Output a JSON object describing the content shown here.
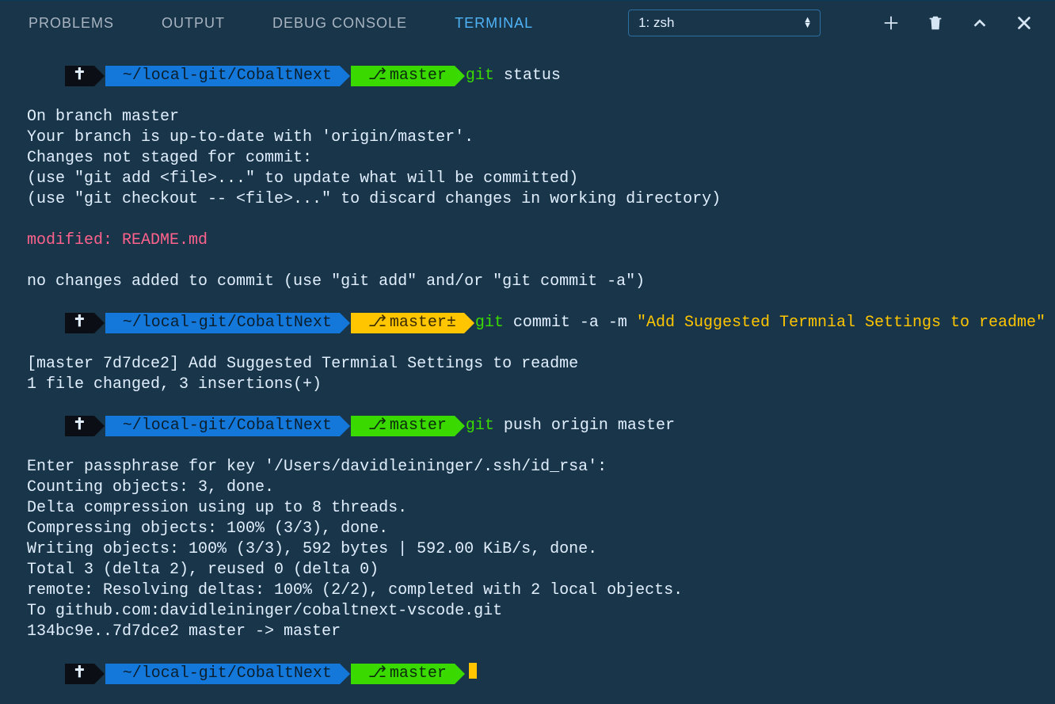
{
  "tabs": {
    "problems": "PROBLEMS",
    "output": "OUTPUT",
    "debug": "DEBUG CONSOLE",
    "terminal": "TERMINAL"
  },
  "shell": {
    "label": "1: zsh"
  },
  "prompt": {
    "sym": "✝",
    "path": "~/local-git/CobaltNext",
    "branch": "master",
    "branch_dirty": "master±"
  },
  "cmd1": {
    "git": "git",
    "rest": " status"
  },
  "status_out": {
    "l1": "On branch master",
    "l2": "Your branch is up-to-date with 'origin/master'.",
    "l3": "Changes not staged for commit:",
    "l4": "  (use \"git add <file>...\" to update what will be committed)",
    "l5": "  (use \"git checkout -- <file>...\" to discard changes in working directory)",
    "mod_label": "        modified:   ",
    "mod_file": "README.md",
    "l7": "no changes added to commit (use \"git add\" and/or \"git commit -a\")"
  },
  "cmd2": {
    "git": "git",
    "rest": " commit -a -m ",
    "msg": "\"Add Suggested Termnial Settings to readme\""
  },
  "commit_out": {
    "l1": "[master 7d7dce2] Add Suggested Termnial Settings to readme",
    "l2": " 1 file changed, 3 insertions(+)"
  },
  "cmd3": {
    "git": "git",
    "rest": " push origin master"
  },
  "push_out": {
    "l1": "Enter passphrase for key '/Users/davidleininger/.ssh/id_rsa':",
    "l2": "Counting objects: 3, done.",
    "l3": "Delta compression using up to 8 threads.",
    "l4": "Compressing objects: 100% (3/3), done.",
    "l5": "Writing objects: 100% (3/3), 592 bytes | 592.00 KiB/s, done.",
    "l6": "Total 3 (delta 2), reused 0 (delta 0)",
    "l7": "remote: Resolving deltas: 100% (2/2), completed with 2 local objects.",
    "l8": "To github.com:davidleininger/cobaltnext-vscode.git",
    "l9": "   134bc9e..7d7dce2  master -> master"
  }
}
